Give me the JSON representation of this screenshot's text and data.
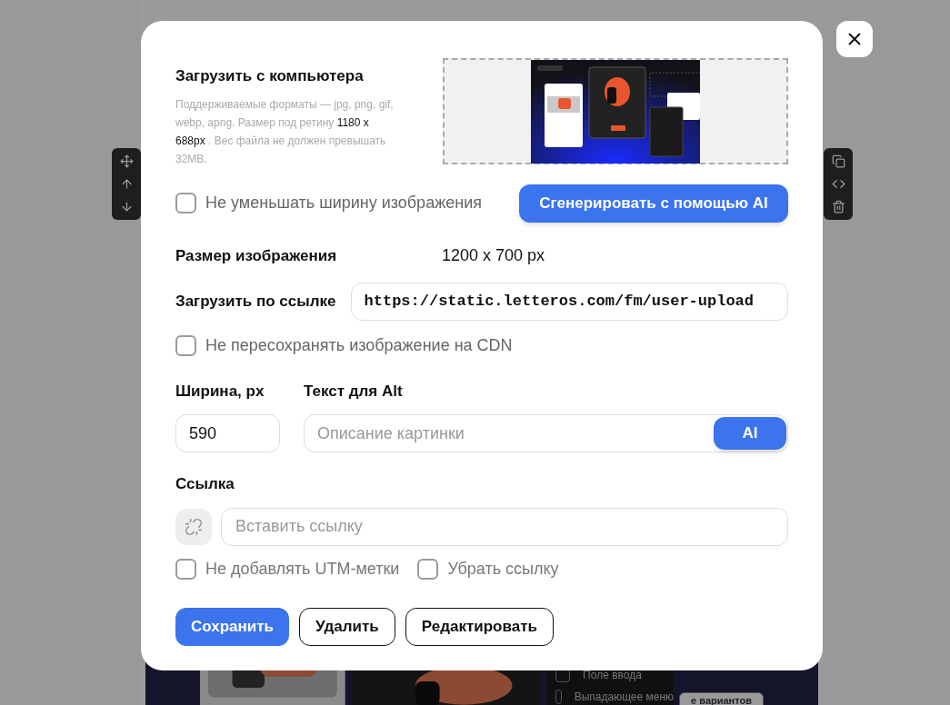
{
  "background": {
    "menu_items": [
      "Поле ввода",
      "Выпадающее меню"
    ],
    "button_fragment": "е вариантов"
  },
  "dialog": {
    "upload": {
      "title": "Загрузить с компьютера",
      "description": "Поддерживаемые форматы — jpg, png, gif, webp, apng. Размер под ретину **1180 x 688px** . Вес файла не должен превышать 32MB."
    },
    "no_shrink": {
      "label": "Не уменьшать ширину изображения",
      "checked": false
    },
    "ai_generate_button": "Сгенерировать с помощью AI",
    "image_size": {
      "label": "Размер изображения",
      "value": "1200 x 700 px"
    },
    "url": {
      "label": "Загрузить по ссылке",
      "value": "https://static.letteros.com/fm/user-upload"
    },
    "no_cdn": {
      "label": "Не пересохранять изображение на CDN",
      "checked": false
    },
    "width": {
      "label": "Ширина, px",
      "value": "590"
    },
    "alt": {
      "label": "Текст для Alt",
      "placeholder": "Описание картинки",
      "ai_button": "AI"
    },
    "link": {
      "label": "Ссылка",
      "placeholder": "Вставить ссылку"
    },
    "link_options": [
      {
        "label": "Не добавлять UTM-метки",
        "checked": false
      },
      {
        "label": "Убрать ссылку",
        "checked": false
      }
    ],
    "buttons": [
      {
        "label": "Сохранить",
        "kind": "primary"
      },
      {
        "label": "Удалить",
        "kind": "outline"
      },
      {
        "label": "Редактировать",
        "kind": "outline"
      }
    ]
  }
}
